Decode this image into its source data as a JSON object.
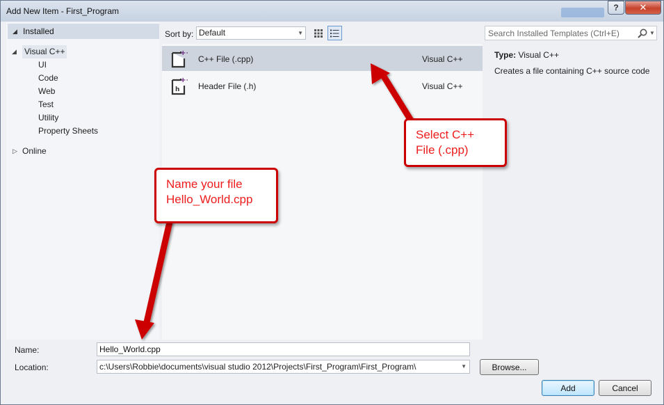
{
  "window": {
    "title": "Add New Item - First_Program",
    "help_label": "?",
    "close_label": "✕"
  },
  "tree": {
    "installed_label": "Installed",
    "visual_cpp_label": "Visual C++",
    "children": [
      "UI",
      "Code",
      "Web",
      "Test",
      "Utility",
      "Property Sheets"
    ],
    "online_label": "Online"
  },
  "toolbar": {
    "sort_label": "Sort by:",
    "sort_value": "Default",
    "search_placeholder": "Search Installed Templates (Ctrl+E)"
  },
  "templates": [
    {
      "name": "C++ File (.cpp)",
      "language": "Visual C++",
      "icon": "cpp-file-icon"
    },
    {
      "name": "Header File (.h)",
      "language": "Visual C++",
      "icon": "header-file-icon"
    }
  ],
  "details": {
    "type_label": "Type:",
    "type_value": "Visual C++",
    "description": "Creates a file containing C++ source code"
  },
  "form": {
    "name_label": "Name:",
    "name_value": "Hello_World.cpp",
    "location_label": "Location:",
    "location_value": "c:\\Users\\Robbie\\documents\\visual studio 2012\\Projects\\First_Program\\First_Program\\",
    "browse_label": "Browse...",
    "add_label": "Add",
    "cancel_label": "Cancel"
  },
  "annotations": {
    "callout_select": [
      "Select C++",
      "File (.cpp)"
    ],
    "callout_name": [
      "Name your file",
      "Hello_World.cpp"
    ]
  },
  "colors": {
    "callout_red": "#ee1c1c",
    "selection_gray": "#cdd4de",
    "plus_purple": "#68217a"
  }
}
